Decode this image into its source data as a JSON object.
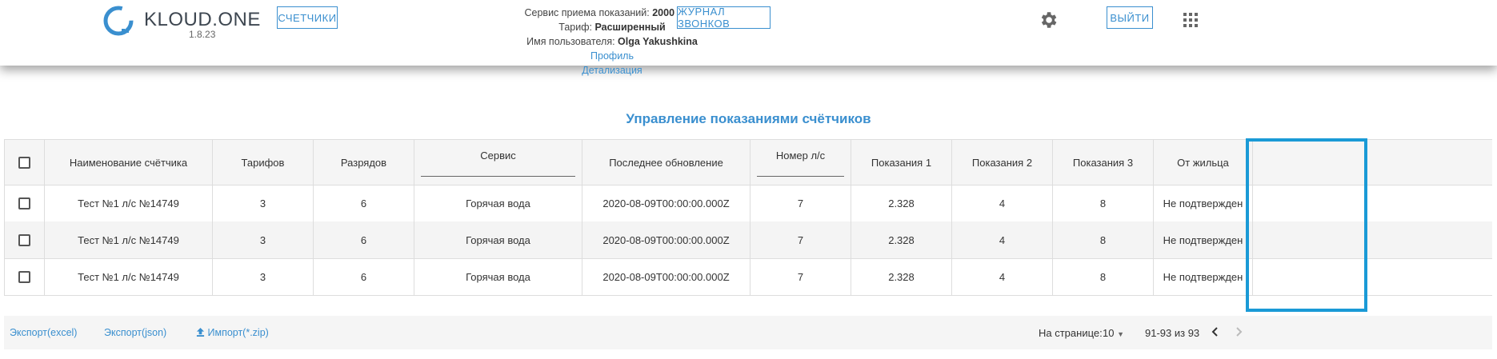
{
  "header": {
    "logo_text": "KLOUD.ONE",
    "logo_version": "1.8.23",
    "meters_button": "СЧЕТЧИКИ",
    "calls_button": "ЖУРНАЛ ЗВОНКОВ",
    "logout_button": "ВЫЙТИ",
    "service_label": "Сервис приема показаний:",
    "service_value": "2000 мин.",
    "tariff_label": "Тариф:",
    "tariff_value": "Расширенный",
    "user_label": "Имя пользователя:",
    "user_value": "Olga Yakushkina",
    "profile_link": "Профиль",
    "details_link": "Детализация",
    "gear_icon": "gear-icon",
    "grid_icon": "apps-grid-icon"
  },
  "page_title": "Управление показаниями счётчиков",
  "table": {
    "columns": [
      "Наименование счётчика",
      "Тарифов",
      "Разрядов",
      "Сервис",
      "Последнее обновление",
      "Номер л/с",
      "Показания 1",
      "Показания 2",
      "Показания 3",
      "От жильца"
    ],
    "rows": [
      [
        "Тест №1 л/с №14749",
        "3",
        "6",
        "Горячая вода",
        "2020-08-09T00:00:00.000Z",
        "7",
        "2.328",
        "4",
        "8",
        "Не подтвержден"
      ],
      [
        "Тест №1 л/с №14749",
        "3",
        "6",
        "Горячая вода",
        "2020-08-09T00:00:00.000Z",
        "7",
        "2.328",
        "4",
        "8",
        "Не подтвержден"
      ],
      [
        "Тест №1 л/с №14749",
        "3",
        "6",
        "Горячая вода",
        "2020-08-09T00:00:00.000Z",
        "7",
        "2.328",
        "4",
        "8",
        "Не подтвержден"
      ]
    ]
  },
  "footer": {
    "export_excel": "Экспорт(excel)",
    "export_json": "Экспорт(json)",
    "import_zip": "Импорт(*.zip)",
    "per_page_label": "На странице:",
    "per_page_value": "10",
    "range": "91-93 из 93"
  },
  "colors": {
    "accent": "#3a8fcf",
    "highlight": "#1a9ad6"
  }
}
